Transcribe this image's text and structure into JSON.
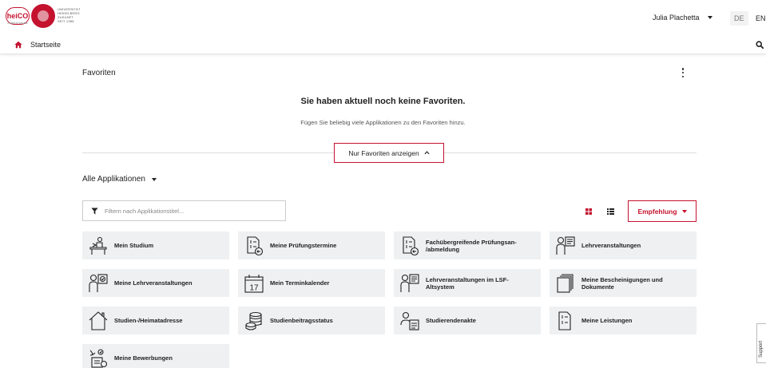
{
  "header": {
    "logo_heico_text": "heiCO",
    "logo_heico_sub": "CAMPUS ONLINE",
    "logo_uni_lines": [
      "UNIVERSITÄT",
      "HEIDELBERG",
      "ZUKUNFT",
      "SEIT 1386"
    ],
    "user_name": "Julia Plachetta",
    "lang_de": "DE",
    "lang_en": "EN"
  },
  "nav": {
    "home_label": "Startseite"
  },
  "favorites": {
    "header": "Favoriten",
    "empty_title": "Sie haben aktuell noch keine Favoriten.",
    "empty_sub": "Fügen Sie beliebig viele Applikationen zu den Favoriten hinzu.",
    "toggle_label": "Nur Favoriten anzeigen"
  },
  "apps": {
    "header": "Alle Applikationen",
    "filter_placeholder": "Filtern nach Applikationstitel...",
    "sort_label": "Empfehlung",
    "tiles": [
      {
        "label": "Mein Studium",
        "icon": "desk-person-icon"
      },
      {
        "label": "Meine Prüfungstermine",
        "icon": "exam-dates-icon"
      },
      {
        "label": "Fachübergreifende Prüfungsan-\n/abmeldung",
        "icon": "exam-registration-icon"
      },
      {
        "label": "Lehrveranstaltungen",
        "icon": "teaching-person-icon"
      },
      {
        "label": "Meine Lehrveranstaltungen",
        "icon": "my-courses-icon"
      },
      {
        "label": "Mein Terminkalender",
        "icon": "calendar-icon"
      },
      {
        "label": "Lehrveranstaltungen im LSF-\nAltsystem",
        "icon": "teaching-person-icon"
      },
      {
        "label": "Meine Bescheinigungen und\nDokumente",
        "icon": "documents-icon"
      },
      {
        "label": "Studien-/Heimatadresse",
        "icon": "house-icon"
      },
      {
        "label": "Studienbeitragsstatus",
        "icon": "coins-icon"
      },
      {
        "label": "Studierendenakte",
        "icon": "student-file-icon"
      },
      {
        "label": "Meine Leistungen",
        "icon": "achievements-icon"
      },
      {
        "label": "Meine Bewerbungen",
        "icon": "applications-icon"
      }
    ]
  },
  "support": {
    "label": "Support"
  },
  "colors": {
    "accent": "#c4122f",
    "tile_bg": "#eef0f1"
  }
}
